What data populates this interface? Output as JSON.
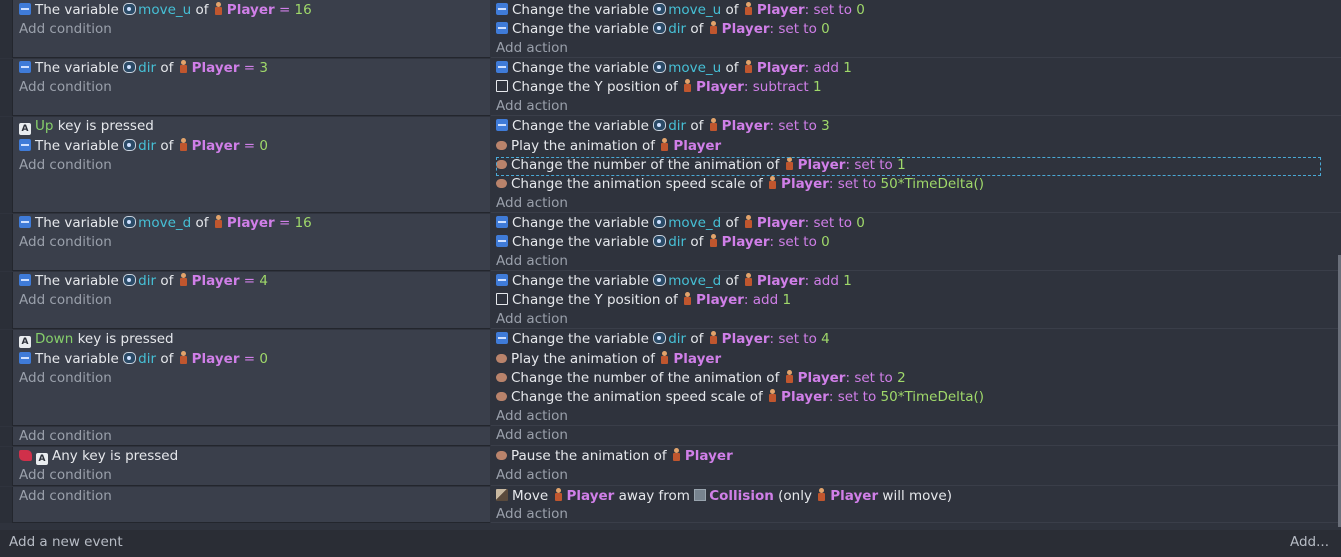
{
  "colors": {
    "background": "#2f333d",
    "condition_bg": "#3a3f4b",
    "variable": "#46c0d6",
    "object": "#d07fe8",
    "number": "#9fd86a",
    "key": "#86cf6b"
  },
  "labels": {
    "add_condition": "Add condition",
    "add_action": "Add action",
    "of": "of",
    "the_variable": "The variable",
    "change_variable": "Change the variable",
    "set_to": "set to",
    "add": "add",
    "subtract": "subtract",
    "key_is_pressed": "key is pressed",
    "change_y": "Change the Y position of",
    "play_anim": "Play the animation of",
    "change_anim_num": "Change the number of the animation of",
    "change_anim_speed": "Change the animation speed scale of",
    "pause_anim": "Pause the animation of",
    "any_key": "Any key is pressed",
    "move": "Move",
    "away_from": "away from",
    "only_prefix": "(only",
    "will_move": "will move)"
  },
  "objects": {
    "player": "Player",
    "collision": "Collision"
  },
  "variables": {
    "move_u": "move_u",
    "move_d": "move_d",
    "dir": "dir"
  },
  "keys": {
    "up": "Up",
    "down": "Down"
  },
  "values": {
    "zero": "0",
    "one": "1",
    "two": "2",
    "three": "3",
    "four": "4",
    "sixteen": "16",
    "speed_expr": "50*TimeDelta()"
  },
  "footer": {
    "add_event": "Add a new event",
    "add_more": "Add..."
  }
}
